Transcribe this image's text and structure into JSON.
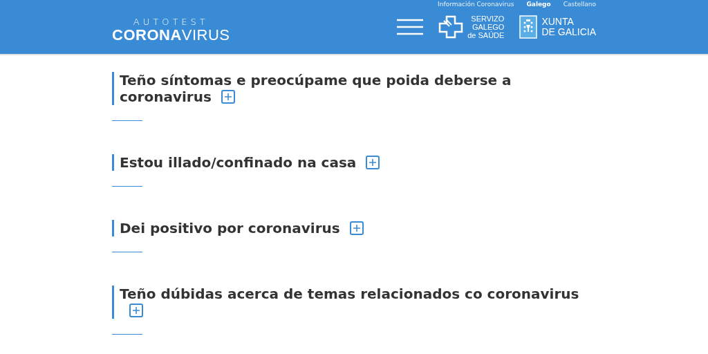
{
  "top_links": [
    {
      "label": "Información Coronavirus",
      "selected": false
    },
    {
      "label": "Galego",
      "selected": true
    },
    {
      "label": "Castellano",
      "selected": false
    }
  ],
  "logo": {
    "line1": "AUTOTEST",
    "bold": "CORONA",
    "light": "VIRUS"
  },
  "partners": [
    {
      "kind": "sergas",
      "lines": [
        "SERVIZO",
        "GALEGO",
        "de SAÚDE"
      ]
    },
    {
      "kind": "xunta",
      "lines": [
        "XUNTA",
        "DE GALICIA"
      ]
    }
  ],
  "sections": [
    {
      "title": "Teño síntomas e preocúpame que poida deberse a coronavirus",
      "expanded": false
    },
    {
      "title": "Estou illado/confinado na casa",
      "expanded": false
    },
    {
      "title": "Dei positivo por coronavirus",
      "expanded": false
    },
    {
      "title": "Teño dúbidas acerca de temas relacionados co coronavirus",
      "expanded": false
    }
  ]
}
